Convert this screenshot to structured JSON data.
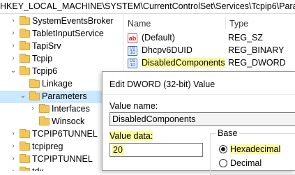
{
  "address_bar": {
    "path": "HKEY_LOCAL_MACHINE\\SYSTEM\\CurrentControlSet\\Services\\Tcpip6\\Paramete"
  },
  "tree": {
    "items": [
      {
        "label": "SystemEventsBroker"
      },
      {
        "label": "TabletInputService"
      },
      {
        "label": "TapiSrv"
      },
      {
        "label": "Tcpip"
      },
      {
        "label": "Tcpip6"
      },
      {
        "label": "Linkage"
      },
      {
        "label": "Parameters"
      },
      {
        "label": "Interfaces"
      },
      {
        "label": "Winsock"
      },
      {
        "label": "TCPIP6TUNNEL"
      },
      {
        "label": "tcpipreg"
      },
      {
        "label": "TCPIPTUNNEL"
      },
      {
        "label": "tdx"
      }
    ]
  },
  "list": {
    "columns": {
      "name": "Name",
      "type": "Type"
    },
    "rows": [
      {
        "name": "(Default)",
        "type": "REG_SZ",
        "icon": "string-value-icon"
      },
      {
        "name": "Dhcpv6DUID",
        "type": "REG_BINARY",
        "icon": "binary-value-icon"
      },
      {
        "name": "DisabledComponents",
        "type": "REG_DWORD",
        "icon": "binary-value-icon"
      }
    ]
  },
  "dialog": {
    "title": "Edit DWORD (32-bit) Value",
    "value_name_label": "Value name:",
    "value_name": "DisabledComponents",
    "value_data_label": "Value data:",
    "value_data": "20",
    "base": {
      "label": "Base",
      "options": [
        {
          "label": "Hexadecimal",
          "selected": true
        },
        {
          "label": "Decimal",
          "selected": false
        }
      ]
    }
  },
  "colors": {
    "highlight": "#fbfb9c",
    "selection": "#cce8ff",
    "folder": "#f1c75c"
  }
}
